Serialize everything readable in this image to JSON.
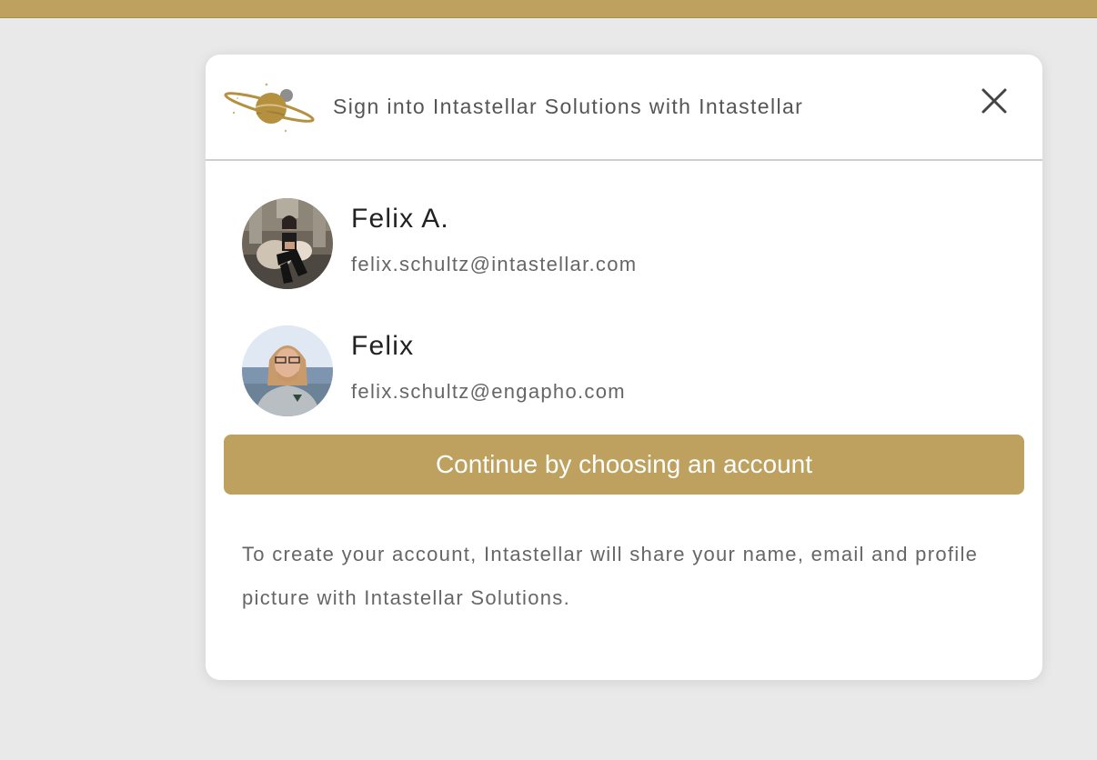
{
  "colors": {
    "accent": "#bea15e",
    "background": "#e9e9e9",
    "dialog": "#ffffff",
    "title_text": "#555555",
    "name_text": "#222222",
    "secondary_text": "#666666"
  },
  "dialog": {
    "title": "Sign into Intastellar Solutions with Intastellar",
    "logo_icon": "saturn-planet-logo",
    "close_icon": "close-x-icon"
  },
  "accounts": [
    {
      "name": "Felix A.",
      "email": "felix.schultz@intastellar.com",
      "avatar_icon": "profile-photo"
    },
    {
      "name": "Felix",
      "email": "felix.schultz@engapho.com",
      "avatar_icon": "profile-photo"
    }
  ],
  "continue_button": {
    "label": "Continue by choosing an account"
  },
  "disclaimer": "To create your account, Intastellar will share your name, email and profile picture with Intastellar Solutions."
}
